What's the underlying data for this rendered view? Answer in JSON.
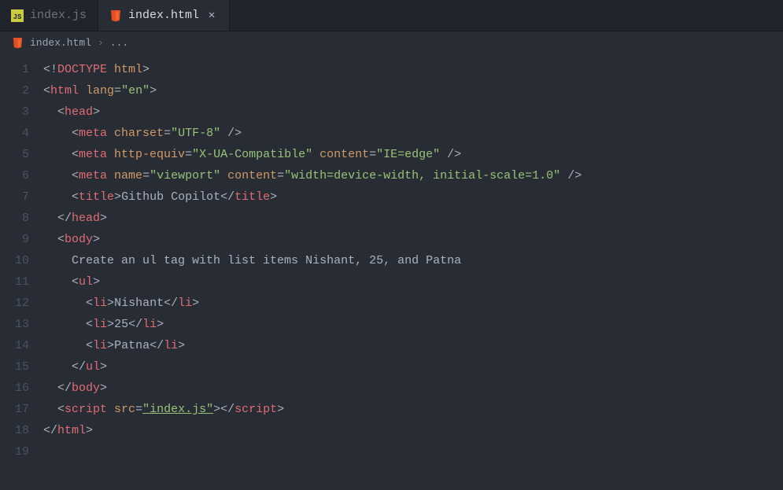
{
  "tabs": [
    {
      "label": "index.js",
      "icon": "js-file-icon",
      "active": false
    },
    {
      "label": "index.html",
      "icon": "html-file-icon",
      "active": true
    }
  ],
  "breadcrumb": {
    "icon": "html-file-icon",
    "file": "index.html",
    "sep": "›",
    "trail": "..."
  },
  "code": {
    "lines": [
      {
        "n": "1",
        "segs": [
          {
            "t": "<!",
            "c": "c-punc"
          },
          {
            "t": "DOCTYPE",
            "c": "c-doctype"
          },
          {
            "t": " html",
            "c": "c-attr"
          },
          {
            "t": ">",
            "c": "c-punc"
          }
        ],
        "indent": 0
      },
      {
        "n": "2",
        "segs": [
          {
            "t": "<",
            "c": "c-punc"
          },
          {
            "t": "html",
            "c": "c-tag"
          },
          {
            "t": " lang",
            "c": "c-attr"
          },
          {
            "t": "=",
            "c": "c-punc"
          },
          {
            "t": "\"en\"",
            "c": "c-string"
          },
          {
            "t": ">",
            "c": "c-punc"
          }
        ],
        "indent": 0
      },
      {
        "n": "3",
        "segs": [
          {
            "t": "<",
            "c": "c-punc"
          },
          {
            "t": "head",
            "c": "c-tag"
          },
          {
            "t": ">",
            "c": "c-punc"
          }
        ],
        "indent": 1
      },
      {
        "n": "4",
        "segs": [
          {
            "t": "<",
            "c": "c-punc"
          },
          {
            "t": "meta",
            "c": "c-tag"
          },
          {
            "t": " charset",
            "c": "c-attr"
          },
          {
            "t": "=",
            "c": "c-punc"
          },
          {
            "t": "\"UTF-8\"",
            "c": "c-string"
          },
          {
            "t": " />",
            "c": "c-punc"
          }
        ],
        "indent": 2
      },
      {
        "n": "5",
        "segs": [
          {
            "t": "<",
            "c": "c-punc"
          },
          {
            "t": "meta",
            "c": "c-tag"
          },
          {
            "t": " http-equiv",
            "c": "c-attr"
          },
          {
            "t": "=",
            "c": "c-punc"
          },
          {
            "t": "\"X-UA-Compatible\"",
            "c": "c-string"
          },
          {
            "t": " content",
            "c": "c-attr"
          },
          {
            "t": "=",
            "c": "c-punc"
          },
          {
            "t": "\"IE=edge\"",
            "c": "c-string"
          },
          {
            "t": " />",
            "c": "c-punc"
          }
        ],
        "indent": 2
      },
      {
        "n": "6",
        "segs": [
          {
            "t": "<",
            "c": "c-punc"
          },
          {
            "t": "meta",
            "c": "c-tag"
          },
          {
            "t": " name",
            "c": "c-attr"
          },
          {
            "t": "=",
            "c": "c-punc"
          },
          {
            "t": "\"viewport\"",
            "c": "c-string"
          },
          {
            "t": " content",
            "c": "c-attr"
          },
          {
            "t": "=",
            "c": "c-punc"
          },
          {
            "t": "\"width=device-width, initial-scale=1.0\"",
            "c": "c-string"
          },
          {
            "t": " />",
            "c": "c-punc"
          }
        ],
        "indent": 2
      },
      {
        "n": "7",
        "segs": [
          {
            "t": "<",
            "c": "c-punc"
          },
          {
            "t": "title",
            "c": "c-tag"
          },
          {
            "t": ">",
            "c": "c-punc"
          },
          {
            "t": "Github Copilot",
            "c": "c-text"
          },
          {
            "t": "</",
            "c": "c-punc"
          },
          {
            "t": "title",
            "c": "c-tag"
          },
          {
            "t": ">",
            "c": "c-punc"
          }
        ],
        "indent": 2
      },
      {
        "n": "8",
        "segs": [
          {
            "t": "</",
            "c": "c-punc"
          },
          {
            "t": "head",
            "c": "c-tag"
          },
          {
            "t": ">",
            "c": "c-punc"
          }
        ],
        "indent": 1
      },
      {
        "n": "9",
        "segs": [
          {
            "t": "<",
            "c": "c-punc"
          },
          {
            "t": "body",
            "c": "c-tag"
          },
          {
            "t": ">",
            "c": "c-punc"
          }
        ],
        "indent": 1
      },
      {
        "n": "10",
        "segs": [
          {
            "t": "Create an ul tag with list items Nishant, 25, and Patna",
            "c": "c-text"
          }
        ],
        "indent": 2
      },
      {
        "n": "11",
        "segs": [
          {
            "t": "<",
            "c": "c-punc"
          },
          {
            "t": "ul",
            "c": "c-tag"
          },
          {
            "t": ">",
            "c": "c-punc"
          }
        ],
        "indent": 2
      },
      {
        "n": "12",
        "segs": [
          {
            "t": "<",
            "c": "c-punc"
          },
          {
            "t": "li",
            "c": "c-tag"
          },
          {
            "t": ">",
            "c": "c-punc"
          },
          {
            "t": "Nishant",
            "c": "c-text"
          },
          {
            "t": "</",
            "c": "c-punc"
          },
          {
            "t": "li",
            "c": "c-tag"
          },
          {
            "t": ">",
            "c": "c-punc"
          }
        ],
        "indent": 3
      },
      {
        "n": "13",
        "segs": [
          {
            "t": "<",
            "c": "c-punc"
          },
          {
            "t": "li",
            "c": "c-tag"
          },
          {
            "t": ">",
            "c": "c-punc"
          },
          {
            "t": "25",
            "c": "c-text"
          },
          {
            "t": "</",
            "c": "c-punc"
          },
          {
            "t": "li",
            "c": "c-tag"
          },
          {
            "t": ">",
            "c": "c-punc"
          }
        ],
        "indent": 3
      },
      {
        "n": "14",
        "segs": [
          {
            "t": "<",
            "c": "c-punc"
          },
          {
            "t": "li",
            "c": "c-tag"
          },
          {
            "t": ">",
            "c": "c-punc"
          },
          {
            "t": "Patna",
            "c": "c-text"
          },
          {
            "t": "</",
            "c": "c-punc"
          },
          {
            "t": "li",
            "c": "c-tag"
          },
          {
            "t": ">",
            "c": "c-punc"
          }
        ],
        "indent": 3
      },
      {
        "n": "15",
        "segs": [
          {
            "t": "</",
            "c": "c-punc"
          },
          {
            "t": "ul",
            "c": "c-tag"
          },
          {
            "t": ">",
            "c": "c-punc"
          }
        ],
        "indent": 2
      },
      {
        "n": "16",
        "segs": [
          {
            "t": "</",
            "c": "c-punc"
          },
          {
            "t": "body",
            "c": "c-tag"
          },
          {
            "t": ">",
            "c": "c-punc"
          }
        ],
        "indent": 1
      },
      {
        "n": "17",
        "segs": [
          {
            "t": "<",
            "c": "c-punc"
          },
          {
            "t": "script",
            "c": "c-tag"
          },
          {
            "t": " src",
            "c": "c-attr"
          },
          {
            "t": "=",
            "c": "c-punc"
          },
          {
            "t": "\"index.js\"",
            "c": "c-string underline"
          },
          {
            "t": ">",
            "c": "c-punc"
          },
          {
            "t": "</",
            "c": "c-punc"
          },
          {
            "t": "script",
            "c": "c-tag"
          },
          {
            "t": ">",
            "c": "c-punc"
          }
        ],
        "indent": 1
      },
      {
        "n": "18",
        "segs": [
          {
            "t": "</",
            "c": "c-punc"
          },
          {
            "t": "html",
            "c": "c-tag"
          },
          {
            "t": ">",
            "c": "c-punc"
          }
        ],
        "indent": 0
      },
      {
        "n": "19",
        "segs": [],
        "indent": 0
      }
    ]
  }
}
